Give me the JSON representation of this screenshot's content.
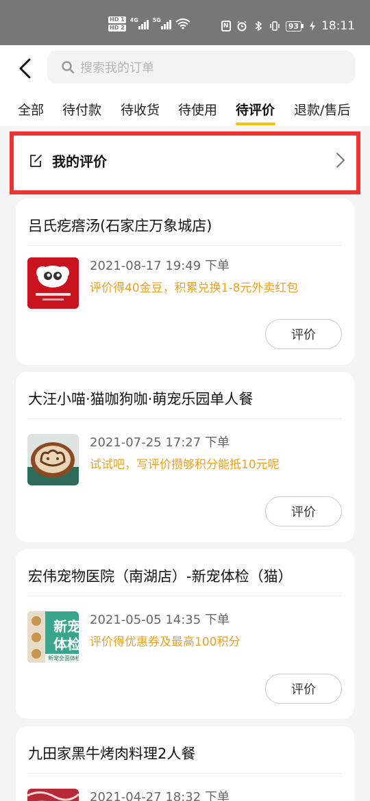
{
  "status_bar": {
    "hd1": "HD 1",
    "hd2": "HD 2",
    "net1": "4G",
    "net2": "5G",
    "battery": "93",
    "time": "18:11"
  },
  "search": {
    "placeholder": "搜索我的订单"
  },
  "tabs": [
    {
      "label": "全部"
    },
    {
      "label": "待付款"
    },
    {
      "label": "待收货"
    },
    {
      "label": "待使用"
    },
    {
      "label": "待评价",
      "active": true
    },
    {
      "label": "退款/售后"
    }
  ],
  "my_review": {
    "label": "我的评价"
  },
  "orders": [
    {
      "title": "吕氏疙瘩汤(石家庄万象城店)",
      "time": "2021-08-17 19:49 下单",
      "promo": "评价得40金豆，积累兑换1-8元外卖红包",
      "button": "评价",
      "thumb_icon": "restaurant-logo"
    },
    {
      "title": "大汪小喵·猫咖狗咖·萌宠乐园单人餐",
      "time": "2021-07-25 17:27 下单",
      "promo": "试试吧，写评价攒够积分能抵10元呢",
      "button": "评价",
      "thumb_icon": "latte-art"
    },
    {
      "title": "宏伟宠物医院（南湖店）-新宠体检（猫）",
      "time": "2021-05-05 14:35 下单",
      "promo": "评价得优惠券及最高100积分",
      "button": "评价",
      "thumb_icon": "pet-checkup-poster",
      "thumb_text_1": "新宠",
      "thumb_text_2": "体检",
      "thumb_text_3": "新宠全面体检"
    },
    {
      "title": "九田家黑牛烤肉料理2人餐",
      "time": "2021-04-27 18:32 下单",
      "thumb_icon": "raw-beef"
    }
  ],
  "colors": {
    "accent_yellow": "#f5c400",
    "promo_orange": "#f0a020",
    "highlight_red": "#ee3232"
  }
}
